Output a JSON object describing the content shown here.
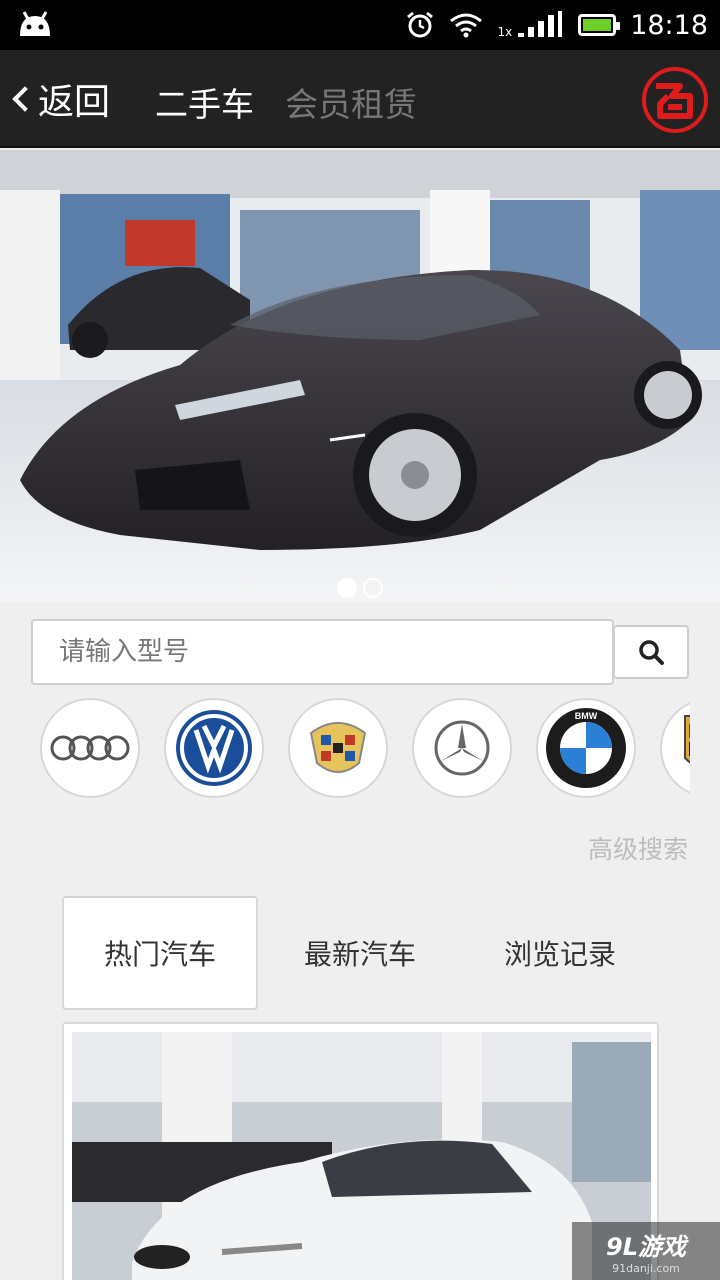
{
  "status_bar": {
    "time": "18:18",
    "signal_label": "1x"
  },
  "header": {
    "back_label": "返回",
    "tab_active": "二手车",
    "tab_inactive": "会员租赁",
    "logo_icon": "ming-logo-icon"
  },
  "banner": {
    "slide_count": 2,
    "active_slide": 1
  },
  "search": {
    "placeholder": "请输入型号",
    "value": ""
  },
  "brands": [
    "audi",
    "volkswagen",
    "cadillac",
    "mercedes-benz",
    "bmw",
    "porsche"
  ],
  "brand_labels": {
    "bmw": "BMW"
  },
  "advanced_search_label": "高级搜索",
  "tabs": [
    {
      "label": "热门汽车",
      "active": true
    },
    {
      "label": "最新汽车",
      "active": false
    },
    {
      "label": "浏览记录",
      "active": false
    }
  ],
  "watermark": {
    "main": "9L游戏",
    "sub": "91danji.com"
  },
  "colors": {
    "accent": "#e01b1b",
    "header_bg": "#222222",
    "battery": "#6fd02b"
  }
}
